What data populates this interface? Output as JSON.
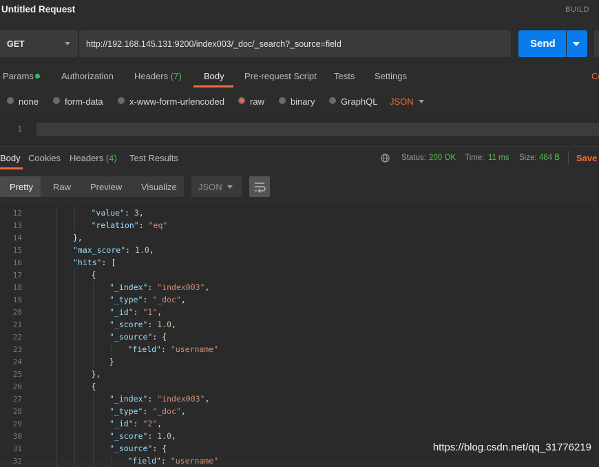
{
  "window": {
    "title": "Untitled Request",
    "build_label": "BUILD"
  },
  "request": {
    "method": "GET",
    "url": "http://192.168.145.131:9200/index003/_doc/_search?_source=field",
    "send_label": "Send"
  },
  "request_tabs": {
    "params": "Params",
    "authorization": "Authorization",
    "headers": "Headers",
    "headers_count": "(7)",
    "body": "Body",
    "prerequest": "Pre-request Script",
    "tests": "Tests",
    "settings": "Settings",
    "cookies_cut": "Co"
  },
  "body_types": {
    "none": "none",
    "form_data": "form-data",
    "urlencoded": "x-www-form-urlencoded",
    "raw": "raw",
    "binary": "binary",
    "graphql": "GraphQL",
    "json": "JSON",
    "selected": "raw"
  },
  "request_editor": {
    "line_number": "1"
  },
  "response_tabs": {
    "body": "Body",
    "cookies": "Cookies",
    "headers": "Headers",
    "headers_count": "(4)",
    "test_results": "Test Results"
  },
  "status": {
    "status_label": "Status:",
    "status_value": "200 OK",
    "time_label": "Time:",
    "time_value": "11 ms",
    "size_label": "Size:",
    "size_value": "484 B",
    "save_response": "Save R"
  },
  "view_tabs": {
    "pretty": "Pretty",
    "raw": "Raw",
    "preview": "Preview",
    "visualize": "Visualize",
    "format": "JSON",
    "selected": "Pretty"
  },
  "response_lines": [
    {
      "no": "12",
      "indent": 3,
      "tokens": [
        [
          "k",
          "\"value\""
        ],
        [
          "p",
          ": "
        ],
        [
          "n",
          "3"
        ],
        [
          "p",
          ","
        ]
      ]
    },
    {
      "no": "13",
      "indent": 3,
      "tokens": [
        [
          "k",
          "\"relation\""
        ],
        [
          "p",
          ": "
        ],
        [
          "s",
          "\"eq\""
        ]
      ]
    },
    {
      "no": "14",
      "indent": 2,
      "tokens": [
        [
          "p",
          "},"
        ]
      ]
    },
    {
      "no": "15",
      "indent": 2,
      "tokens": [
        [
          "k",
          "\"max_score\""
        ],
        [
          "p",
          ": "
        ],
        [
          "n",
          "1.0"
        ],
        [
          "p",
          ","
        ]
      ]
    },
    {
      "no": "16",
      "indent": 2,
      "tokens": [
        [
          "k",
          "\"hits\""
        ],
        [
          "p",
          ": ["
        ]
      ]
    },
    {
      "no": "17",
      "indent": 3,
      "tokens": [
        [
          "p",
          "{"
        ]
      ]
    },
    {
      "no": "18",
      "indent": 4,
      "tokens": [
        [
          "k",
          "\"_index\""
        ],
        [
          "p",
          ": "
        ],
        [
          "s",
          "\"index003\""
        ],
        [
          "p",
          ","
        ]
      ]
    },
    {
      "no": "19",
      "indent": 4,
      "tokens": [
        [
          "k",
          "\"_type\""
        ],
        [
          "p",
          ": "
        ],
        [
          "s",
          "\"_doc\""
        ],
        [
          "p",
          ","
        ]
      ]
    },
    {
      "no": "20",
      "indent": 4,
      "tokens": [
        [
          "k",
          "\"_id\""
        ],
        [
          "p",
          ": "
        ],
        [
          "s",
          "\"1\""
        ],
        [
          "p",
          ","
        ]
      ]
    },
    {
      "no": "21",
      "indent": 4,
      "tokens": [
        [
          "k",
          "\"_score\""
        ],
        [
          "p",
          ": "
        ],
        [
          "n",
          "1.0"
        ],
        [
          "p",
          ","
        ]
      ]
    },
    {
      "no": "22",
      "indent": 4,
      "tokens": [
        [
          "k",
          "\"_source\""
        ],
        [
          "p",
          ": {"
        ]
      ]
    },
    {
      "no": "23",
      "indent": 5,
      "tokens": [
        [
          "k",
          "\"field\""
        ],
        [
          "p",
          ": "
        ],
        [
          "s",
          "\"username\""
        ]
      ]
    },
    {
      "no": "24",
      "indent": 4,
      "tokens": [
        [
          "p",
          "}"
        ]
      ]
    },
    {
      "no": "25",
      "indent": 3,
      "tokens": [
        [
          "p",
          "},"
        ]
      ]
    },
    {
      "no": "26",
      "indent": 3,
      "tokens": [
        [
          "p",
          "{"
        ]
      ]
    },
    {
      "no": "27",
      "indent": 4,
      "tokens": [
        [
          "k",
          "\"_index\""
        ],
        [
          "p",
          ": "
        ],
        [
          "s",
          "\"index003\""
        ],
        [
          "p",
          ","
        ]
      ]
    },
    {
      "no": "28",
      "indent": 4,
      "tokens": [
        [
          "k",
          "\"_type\""
        ],
        [
          "p",
          ": "
        ],
        [
          "s",
          "\"_doc\""
        ],
        [
          "p",
          ","
        ]
      ]
    },
    {
      "no": "29",
      "indent": 4,
      "tokens": [
        [
          "k",
          "\"_id\""
        ],
        [
          "p",
          ": "
        ],
        [
          "s",
          "\"2\""
        ],
        [
          "p",
          ","
        ]
      ]
    },
    {
      "no": "30",
      "indent": 4,
      "tokens": [
        [
          "k",
          "\"_score\""
        ],
        [
          "p",
          ": "
        ],
        [
          "n",
          "1.0"
        ],
        [
          "p",
          ","
        ]
      ]
    },
    {
      "no": "31",
      "indent": 4,
      "tokens": [
        [
          "k",
          "\"_source\""
        ],
        [
          "p",
          ": {"
        ]
      ]
    },
    {
      "no": "32",
      "indent": 5,
      "tokens": [
        [
          "k",
          "\"field\""
        ],
        [
          "p",
          ": "
        ],
        [
          "s",
          "\"username\""
        ]
      ]
    }
  ],
  "watermark": "https://blog.csdn.net/qq_31776219",
  "colors": {
    "accent": "#f26b3a",
    "send": "#097bed",
    "success": "#5cb85c"
  }
}
